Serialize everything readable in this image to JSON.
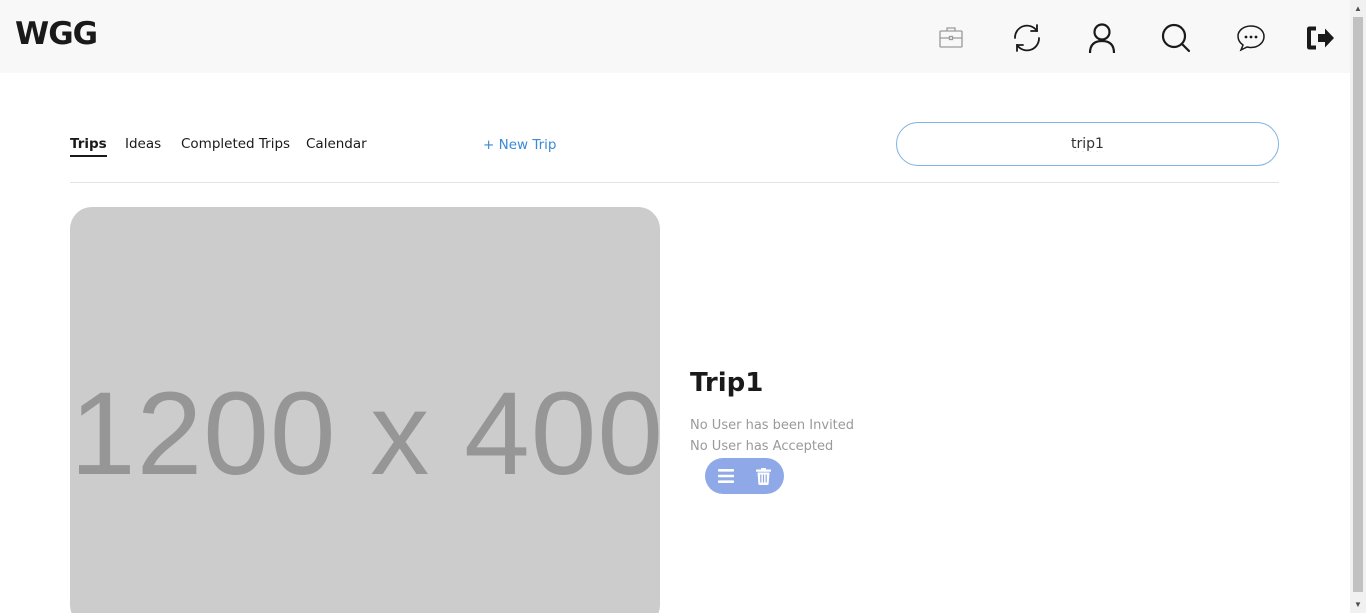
{
  "app": {
    "brand": "WGG"
  },
  "navbar": {
    "icons": [
      "briefcase-icon",
      "sync-icon",
      "user-icon",
      "search-icon",
      "chat-icon",
      "logout-icon"
    ]
  },
  "tabs": {
    "trips": "Trips",
    "ideas": "Ideas",
    "completed_trips": "Completed Trips",
    "calendar": "Calendar",
    "active": "Trips"
  },
  "new_trip_label": "+ New Trip",
  "search": {
    "value": "trip1",
    "placeholder": ""
  },
  "trip": {
    "image_placeholder_text": "1200 x 400",
    "name": "Trip1",
    "invited_status": "No User has been Invited",
    "accepted_status": "No User has Accepted",
    "actions": [
      "menu-icon",
      "trash-icon"
    ]
  },
  "colors": {
    "accent": "#3a8ad6",
    "action_pill": "#8fa9e8",
    "image_bg": "#cccccc",
    "navbar_bg": "#f8f8f8"
  }
}
